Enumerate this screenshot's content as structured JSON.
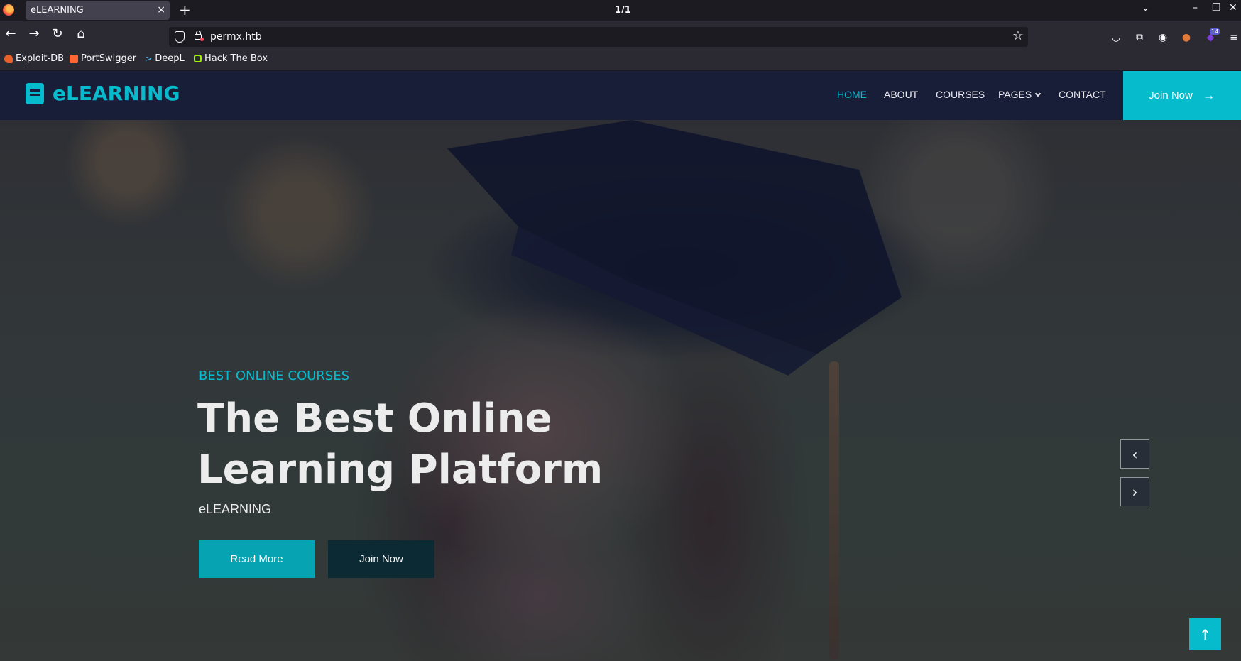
{
  "browser": {
    "tab_title": "eLEARNING",
    "tab_close": "×",
    "new_tab": "+",
    "window_title": "1/1",
    "url": "permx.htb",
    "bookmarks": [
      "Exploit-DB",
      "PortSwigger",
      "DeepL",
      "Hack The Box"
    ],
    "extension_badge": "14"
  },
  "site": {
    "brand": "eLEARNING",
    "nav": [
      "HOME",
      "ABOUT",
      "COURSES",
      "PAGES",
      "CONTACT"
    ],
    "join_now": "Join Now"
  },
  "hero": {
    "subtitle": "BEST ONLINE COURSES",
    "title": "The Best Online Learning Platform",
    "brand": "eLEARNING",
    "read_more": "Read More",
    "join_now": "Join Now"
  },
  "icons": {
    "arrow_right": "→",
    "prev": "‹",
    "next": "›",
    "up": "↑"
  },
  "colors": {
    "accent": "#06bbcc",
    "nav_bg": "#181d38",
    "dark_button": "#0b2a33"
  }
}
